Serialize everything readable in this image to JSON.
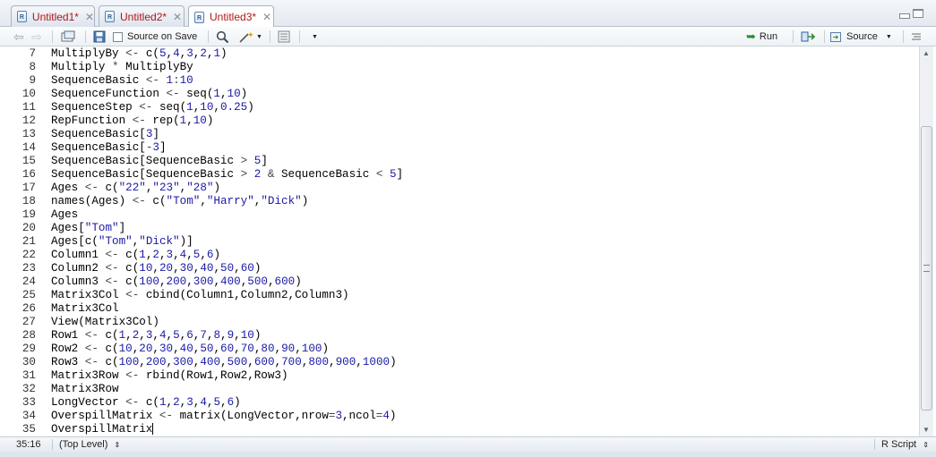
{
  "tabs": [
    {
      "label": "Untitled1*",
      "active": false
    },
    {
      "label": "Untitled2*",
      "active": false
    },
    {
      "label": "Untitled3*",
      "active": true
    }
  ],
  "toolbar": {
    "source_on_save": "Source on Save",
    "run": "Run",
    "source": "Source"
  },
  "editor": {
    "lines": [
      {
        "n": "7",
        "code": [
          [
            "MultiplyBy ",
            "id"
          ],
          [
            "<- ",
            "op"
          ],
          [
            "c(",
            "id"
          ],
          [
            "5",
            "num"
          ],
          [
            ",",
            "id"
          ],
          [
            "4",
            "num"
          ],
          [
            ",",
            "id"
          ],
          [
            "3",
            "num"
          ],
          [
            ",",
            "id"
          ],
          [
            "2",
            "num"
          ],
          [
            ",",
            "id"
          ],
          [
            "1",
            "num"
          ],
          [
            ")",
            "id"
          ]
        ]
      },
      {
        "n": "8",
        "code": [
          [
            "Multiply ",
            "id"
          ],
          [
            "* ",
            "op"
          ],
          [
            "MultiplyBy",
            "id"
          ]
        ]
      },
      {
        "n": "9",
        "code": [
          [
            "SequenceBasic ",
            "id"
          ],
          [
            "<- ",
            "op"
          ],
          [
            "1",
            "num"
          ],
          [
            ":",
            "op"
          ],
          [
            "10",
            "num"
          ]
        ]
      },
      {
        "n": "10",
        "code": [
          [
            "SequenceFunction ",
            "id"
          ],
          [
            "<- ",
            "op"
          ],
          [
            "seq(",
            "id"
          ],
          [
            "1",
            "num"
          ],
          [
            ",",
            "id"
          ],
          [
            "10",
            "num"
          ],
          [
            ")",
            "id"
          ]
        ]
      },
      {
        "n": "11",
        "code": [
          [
            "SequenceStep ",
            "id"
          ],
          [
            "<- ",
            "op"
          ],
          [
            "seq(",
            "id"
          ],
          [
            "1",
            "num"
          ],
          [
            ",",
            "id"
          ],
          [
            "10",
            "num"
          ],
          [
            ",",
            "id"
          ],
          [
            "0.25",
            "num"
          ],
          [
            ")",
            "id"
          ]
        ]
      },
      {
        "n": "12",
        "code": [
          [
            "RepFunction ",
            "id"
          ],
          [
            "<- ",
            "op"
          ],
          [
            "rep(",
            "id"
          ],
          [
            "1",
            "num"
          ],
          [
            ",",
            "id"
          ],
          [
            "10",
            "num"
          ],
          [
            ")",
            "id"
          ]
        ]
      },
      {
        "n": "13",
        "code": [
          [
            "SequenceBasic[",
            "id"
          ],
          [
            "3",
            "num"
          ],
          [
            "]",
            "id"
          ]
        ]
      },
      {
        "n": "14",
        "code": [
          [
            "SequenceBasic[",
            "id"
          ],
          [
            "-",
            "op"
          ],
          [
            "3",
            "num"
          ],
          [
            "]",
            "id"
          ]
        ]
      },
      {
        "n": "15",
        "code": [
          [
            "SequenceBasic[SequenceBasic ",
            "id"
          ],
          [
            "> ",
            "op"
          ],
          [
            "5",
            "num"
          ],
          [
            "]",
            "id"
          ]
        ]
      },
      {
        "n": "16",
        "code": [
          [
            "SequenceBasic[SequenceBasic ",
            "id"
          ],
          [
            "> ",
            "op"
          ],
          [
            "2 ",
            "num"
          ],
          [
            "& ",
            "op"
          ],
          [
            "SequenceBasic ",
            "id"
          ],
          [
            "< ",
            "op"
          ],
          [
            "5",
            "num"
          ],
          [
            "]",
            "id"
          ]
        ]
      },
      {
        "n": "17",
        "code": [
          [
            "Ages ",
            "id"
          ],
          [
            "<- ",
            "op"
          ],
          [
            "c(",
            "id"
          ],
          [
            "\"22\"",
            "str"
          ],
          [
            ",",
            "id"
          ],
          [
            "\"23\"",
            "str"
          ],
          [
            ",",
            "id"
          ],
          [
            "\"28\"",
            "str"
          ],
          [
            ")",
            "id"
          ]
        ]
      },
      {
        "n": "18",
        "code": [
          [
            "names(Ages) ",
            "id"
          ],
          [
            "<- ",
            "op"
          ],
          [
            "c(",
            "id"
          ],
          [
            "\"Tom\"",
            "str"
          ],
          [
            ",",
            "id"
          ],
          [
            "\"Harry\"",
            "str"
          ],
          [
            ",",
            "id"
          ],
          [
            "\"Dick\"",
            "str"
          ],
          [
            ")",
            "id"
          ]
        ]
      },
      {
        "n": "19",
        "code": [
          [
            "Ages",
            "id"
          ]
        ]
      },
      {
        "n": "20",
        "code": [
          [
            "Ages[",
            "id"
          ],
          [
            "\"Tom\"",
            "str"
          ],
          [
            "]",
            "id"
          ]
        ]
      },
      {
        "n": "21",
        "code": [
          [
            "Ages[c(",
            "id"
          ],
          [
            "\"Tom\"",
            "str"
          ],
          [
            ",",
            "id"
          ],
          [
            "\"Dick\"",
            "str"
          ],
          [
            ")]",
            "id"
          ]
        ]
      },
      {
        "n": "22",
        "code": [
          [
            "Column1 ",
            "id"
          ],
          [
            "<- ",
            "op"
          ],
          [
            "c(",
            "id"
          ],
          [
            "1",
            "num"
          ],
          [
            ",",
            "id"
          ],
          [
            "2",
            "num"
          ],
          [
            ",",
            "id"
          ],
          [
            "3",
            "num"
          ],
          [
            ",",
            "id"
          ],
          [
            "4",
            "num"
          ],
          [
            ",",
            "id"
          ],
          [
            "5",
            "num"
          ],
          [
            ",",
            "id"
          ],
          [
            "6",
            "num"
          ],
          [
            ")",
            "id"
          ]
        ]
      },
      {
        "n": "23",
        "code": [
          [
            "Column2 ",
            "id"
          ],
          [
            "<- ",
            "op"
          ],
          [
            "c(",
            "id"
          ],
          [
            "10",
            "num"
          ],
          [
            ",",
            "id"
          ],
          [
            "20",
            "num"
          ],
          [
            ",",
            "id"
          ],
          [
            "30",
            "num"
          ],
          [
            ",",
            "id"
          ],
          [
            "40",
            "num"
          ],
          [
            ",",
            "id"
          ],
          [
            "50",
            "num"
          ],
          [
            ",",
            "id"
          ],
          [
            "60",
            "num"
          ],
          [
            ")",
            "id"
          ]
        ]
      },
      {
        "n": "24",
        "code": [
          [
            "Column3 ",
            "id"
          ],
          [
            "<- ",
            "op"
          ],
          [
            "c(",
            "id"
          ],
          [
            "100",
            "num"
          ],
          [
            ",",
            "id"
          ],
          [
            "200",
            "num"
          ],
          [
            ",",
            "id"
          ],
          [
            "300",
            "num"
          ],
          [
            ",",
            "id"
          ],
          [
            "400",
            "num"
          ],
          [
            ",",
            "id"
          ],
          [
            "500",
            "num"
          ],
          [
            ",",
            "id"
          ],
          [
            "600",
            "num"
          ],
          [
            ")",
            "id"
          ]
        ]
      },
      {
        "n": "25",
        "code": [
          [
            "Matrix3Col ",
            "id"
          ],
          [
            "<- ",
            "op"
          ],
          [
            "cbind(Column1,Column2,Column3)",
            "id"
          ]
        ]
      },
      {
        "n": "26",
        "code": [
          [
            "Matrix3Col",
            "id"
          ]
        ]
      },
      {
        "n": "27",
        "code": [
          [
            "View(Matrix3Col)",
            "id"
          ]
        ]
      },
      {
        "n": "28",
        "code": [
          [
            "Row1 ",
            "id"
          ],
          [
            "<- ",
            "op"
          ],
          [
            "c(",
            "id"
          ],
          [
            "1",
            "num"
          ],
          [
            ",",
            "id"
          ],
          [
            "2",
            "num"
          ],
          [
            ",",
            "id"
          ],
          [
            "3",
            "num"
          ],
          [
            ",",
            "id"
          ],
          [
            "4",
            "num"
          ],
          [
            ",",
            "id"
          ],
          [
            "5",
            "num"
          ],
          [
            ",",
            "id"
          ],
          [
            "6",
            "num"
          ],
          [
            ",",
            "id"
          ],
          [
            "7",
            "num"
          ],
          [
            ",",
            "id"
          ],
          [
            "8",
            "num"
          ],
          [
            ",",
            "id"
          ],
          [
            "9",
            "num"
          ],
          [
            ",",
            "id"
          ],
          [
            "10",
            "num"
          ],
          [
            ")",
            "id"
          ]
        ]
      },
      {
        "n": "29",
        "code": [
          [
            "Row2 ",
            "id"
          ],
          [
            "<- ",
            "op"
          ],
          [
            "c(",
            "id"
          ],
          [
            "10",
            "num"
          ],
          [
            ",",
            "id"
          ],
          [
            "20",
            "num"
          ],
          [
            ",",
            "id"
          ],
          [
            "30",
            "num"
          ],
          [
            ",",
            "id"
          ],
          [
            "40",
            "num"
          ],
          [
            ",",
            "id"
          ],
          [
            "50",
            "num"
          ],
          [
            ",",
            "id"
          ],
          [
            "60",
            "num"
          ],
          [
            ",",
            "id"
          ],
          [
            "70",
            "num"
          ],
          [
            ",",
            "id"
          ],
          [
            "80",
            "num"
          ],
          [
            ",",
            "id"
          ],
          [
            "90",
            "num"
          ],
          [
            ",",
            "id"
          ],
          [
            "100",
            "num"
          ],
          [
            ")",
            "id"
          ]
        ]
      },
      {
        "n": "30",
        "code": [
          [
            "Row3 ",
            "id"
          ],
          [
            "<- ",
            "op"
          ],
          [
            "c(",
            "id"
          ],
          [
            "100",
            "num"
          ],
          [
            ",",
            "id"
          ],
          [
            "200",
            "num"
          ],
          [
            ",",
            "id"
          ],
          [
            "300",
            "num"
          ],
          [
            ",",
            "id"
          ],
          [
            "400",
            "num"
          ],
          [
            ",",
            "id"
          ],
          [
            "500",
            "num"
          ],
          [
            ",",
            "id"
          ],
          [
            "600",
            "num"
          ],
          [
            ",",
            "id"
          ],
          [
            "700",
            "num"
          ],
          [
            ",",
            "id"
          ],
          [
            "800",
            "num"
          ],
          [
            ",",
            "id"
          ],
          [
            "900",
            "num"
          ],
          [
            ",",
            "id"
          ],
          [
            "1000",
            "num"
          ],
          [
            ")",
            "id"
          ]
        ]
      },
      {
        "n": "31",
        "code": [
          [
            "Matrix3Row ",
            "id"
          ],
          [
            "<- ",
            "op"
          ],
          [
            "rbind(Row1,Row2,Row3)",
            "id"
          ]
        ]
      },
      {
        "n": "32",
        "code": [
          [
            "Matrix3Row",
            "id"
          ]
        ]
      },
      {
        "n": "33",
        "code": [
          [
            "LongVector ",
            "id"
          ],
          [
            "<- ",
            "op"
          ],
          [
            "c(",
            "id"
          ],
          [
            "1",
            "num"
          ],
          [
            ",",
            "id"
          ],
          [
            "2",
            "num"
          ],
          [
            ",",
            "id"
          ],
          [
            "3",
            "num"
          ],
          [
            ",",
            "id"
          ],
          [
            "4",
            "num"
          ],
          [
            ",",
            "id"
          ],
          [
            "5",
            "num"
          ],
          [
            ",",
            "id"
          ],
          [
            "6",
            "num"
          ],
          [
            ")",
            "id"
          ]
        ]
      },
      {
        "n": "34",
        "code": [
          [
            "OverspillMatrix ",
            "id"
          ],
          [
            "<- ",
            "op"
          ],
          [
            "matrix(LongVector,nrow",
            "id"
          ],
          [
            "=",
            "op"
          ],
          [
            "3",
            "num"
          ],
          [
            ",ncol",
            "id"
          ],
          [
            "=",
            "op"
          ],
          [
            "4",
            "num"
          ],
          [
            ")",
            "id"
          ]
        ]
      },
      {
        "n": "35",
        "code": [
          [
            "OverspillMatrix",
            "id"
          ]
        ]
      }
    ],
    "colors": {
      "id": "#000000",
      "op": "#444444",
      "num": "#1a1aa6",
      "str": "#1a1aa6"
    }
  },
  "status": {
    "position": "35:16",
    "scope": "(Top Level)",
    "file_type": "R Script"
  }
}
